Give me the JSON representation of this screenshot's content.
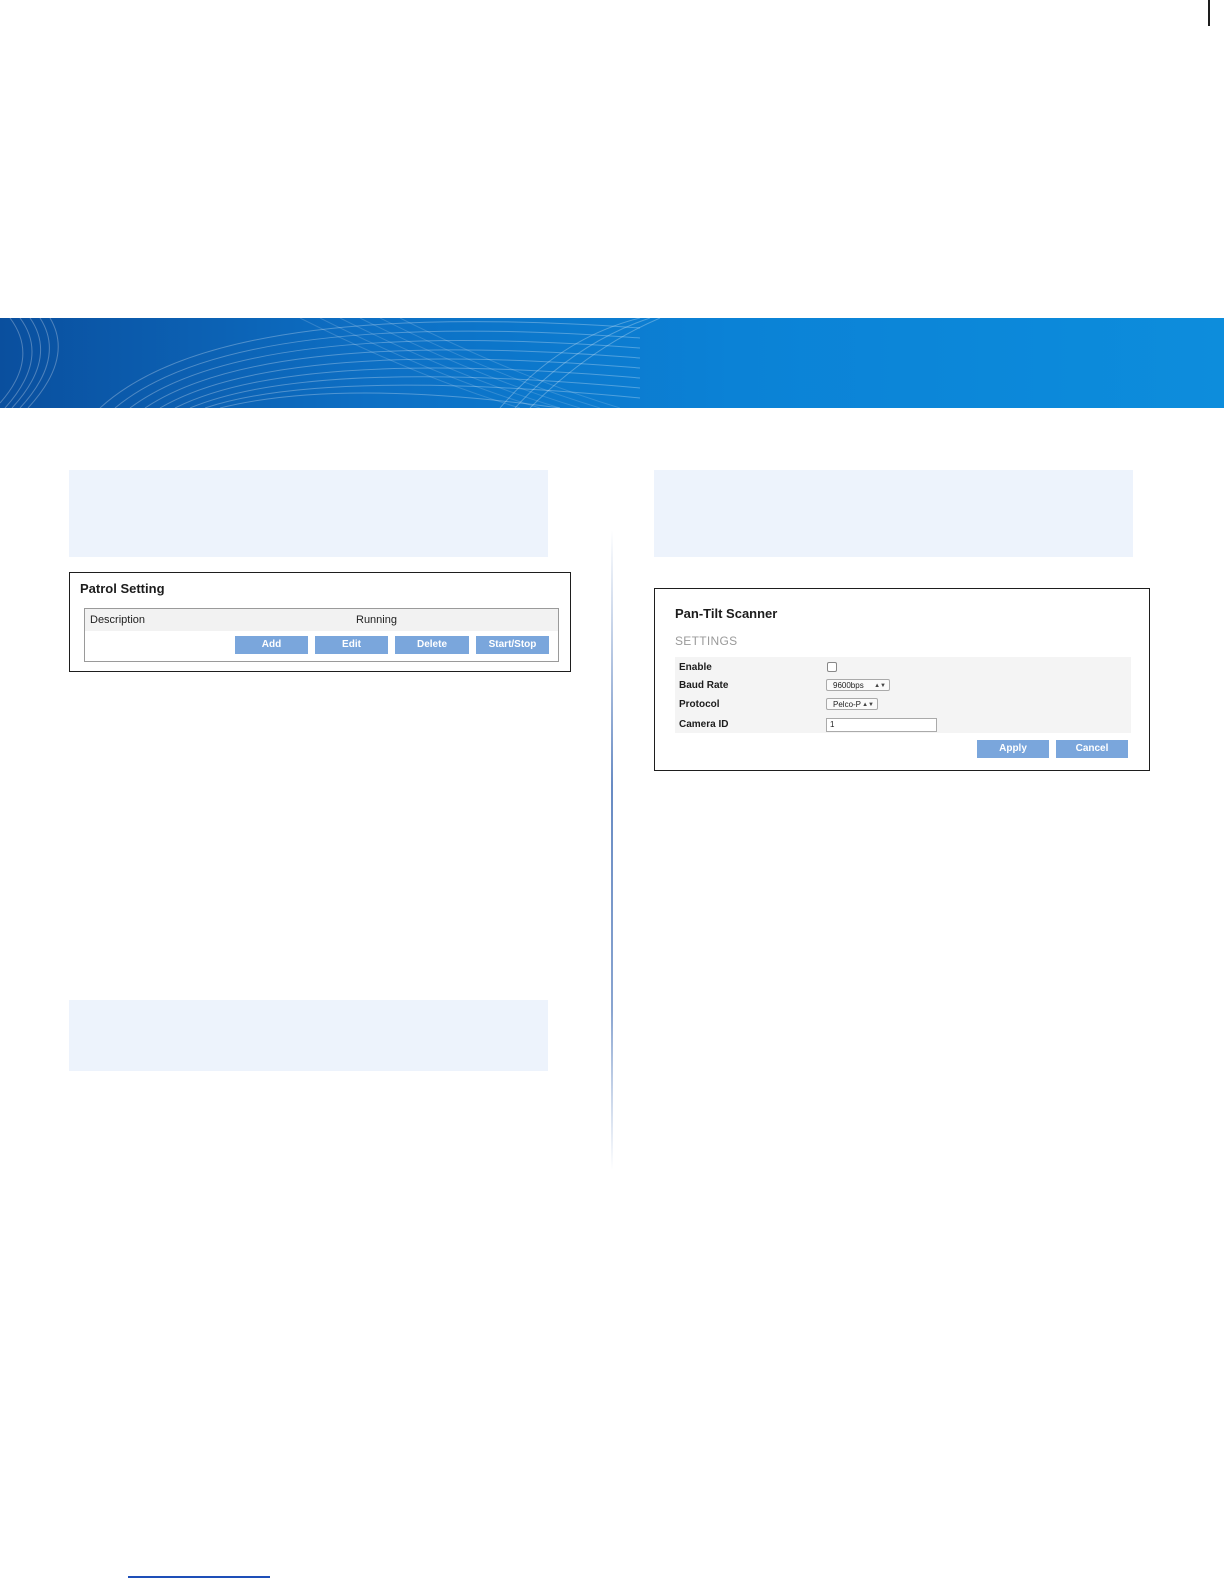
{
  "patrol_panel": {
    "title": "Patrol Setting",
    "columns": [
      "Description",
      "Running"
    ],
    "buttons": {
      "add": "Add",
      "edit": "Edit",
      "delete": "Delete",
      "start_stop": "Start/Stop"
    }
  },
  "pan_tilt_panel": {
    "title": "Pan-Tilt Scanner",
    "section": "SETTINGS",
    "fields": {
      "enable": {
        "label": "Enable",
        "checked": false
      },
      "baud_rate": {
        "label": "Baud Rate",
        "value": "9600bps"
      },
      "protocol": {
        "label": "Protocol",
        "value": "Pelco-P"
      },
      "camera_id": {
        "label": "Camera ID",
        "value": "1"
      }
    },
    "buttons": {
      "apply": "Apply",
      "cancel": "Cancel"
    }
  },
  "colors": {
    "banner": "#0d6fc4",
    "note_background": "#edf3fc",
    "button": "#7aa6dc"
  }
}
